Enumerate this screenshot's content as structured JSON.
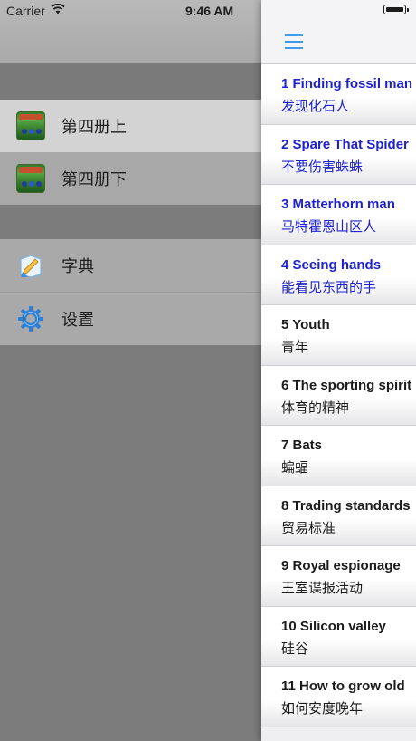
{
  "status_bar": {
    "carrier": "Carrier",
    "time": "9:46 AM"
  },
  "drawer": {
    "books": [
      {
        "label": "第四册上",
        "icon": "textbook-cover-icon"
      },
      {
        "label": "第四册下",
        "icon": "textbook-cover-icon"
      }
    ],
    "tools": [
      {
        "label": "字典",
        "icon": "dictionary-icon"
      },
      {
        "label": "设置",
        "icon": "gear-icon"
      }
    ]
  },
  "lessons": [
    {
      "en": "1 Finding fossil man",
      "zh": "发现化石人",
      "highlighted": true
    },
    {
      "en": "2 Spare That Spider",
      "zh": "不要伤害蛛蛛",
      "highlighted": true
    },
    {
      "en": "3 Matterhorn man",
      "zh": "马特霍恩山区人",
      "highlighted": true
    },
    {
      "en": "4 Seeing hands",
      "zh": "能看见东西的手",
      "highlighted": true
    },
    {
      "en": "5 Youth",
      "zh": "青年",
      "highlighted": false
    },
    {
      "en": "6 The sporting spirit",
      "zh": "体育的精神",
      "highlighted": false
    },
    {
      "en": "7 Bats",
      "zh": "蝙蝠",
      "highlighted": false
    },
    {
      "en": "8 Trading standards",
      "zh": "贸易标准",
      "highlighted": false
    },
    {
      "en": "9 Royal espionage",
      "zh": "王室谍报活动",
      "highlighted": false
    },
    {
      "en": "10 Silicon valley",
      "zh": "硅谷",
      "highlighted": false
    },
    {
      "en": "11 How to grow old",
      "zh": "如何安度晚年",
      "highlighted": false
    }
  ],
  "colors": {
    "highlight_text": "#1f23cf",
    "accent": "#3e9cf0"
  }
}
